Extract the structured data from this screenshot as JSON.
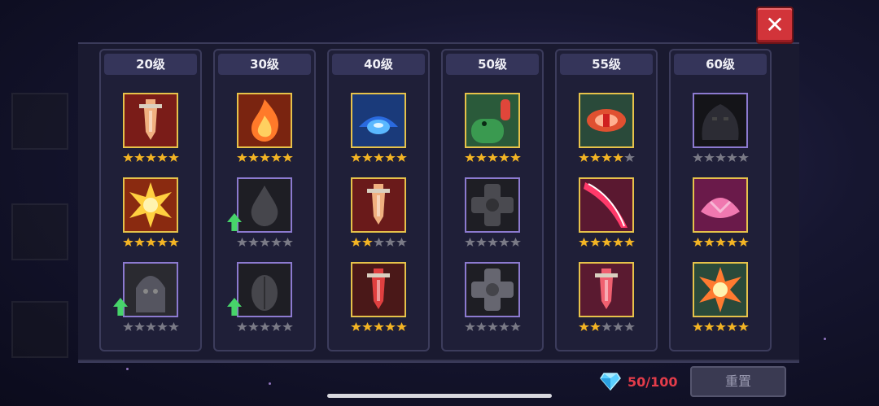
{
  "close_label": "✕",
  "columns": [
    {
      "level": "20级",
      "slots": [
        {
          "icon": "orange-sword-icon",
          "bg": "#7a1c18",
          "fg": "#f0b080",
          "stars_on": 5,
          "locked": false,
          "upgrade": false
        },
        {
          "icon": "explosion-burst-icon",
          "bg": "#8a2a10",
          "fg": "#ffd040",
          "stars_on": 5,
          "locked": false,
          "upgrade": false
        },
        {
          "icon": "hooded-reaper-icon",
          "bg": "#2a2a30",
          "fg": "#555560",
          "stars_on": 0,
          "locked": true,
          "upgrade": true
        }
      ]
    },
    {
      "level": "30级",
      "slots": [
        {
          "icon": "flame-icon",
          "bg": "#7a2410",
          "fg": "#ff7a2a",
          "stars_on": 5,
          "locked": false,
          "upgrade": false
        },
        {
          "icon": "droplet-icon",
          "bg": "#1e1e24",
          "fg": "#46464c",
          "stars_on": 0,
          "locked": true,
          "upgrade": true
        },
        {
          "icon": "seed-leaf-icon",
          "bg": "#1e1e24",
          "fg": "#46464c",
          "stars_on": 0,
          "locked": true,
          "upgrade": true
        }
      ]
    },
    {
      "level": "40级",
      "slots": [
        {
          "icon": "blue-gem-icon",
          "bg": "#1a3a7a",
          "fg": "#5ab8ff",
          "stars_on": 5,
          "locked": false,
          "upgrade": false
        },
        {
          "icon": "orange-sword-icon",
          "bg": "#6a1a1a",
          "fg": "#f0b080",
          "stars_on": 2,
          "locked": false,
          "upgrade": false
        },
        {
          "icon": "red-crystal-sword-icon",
          "bg": "#4a1818",
          "fg": "#e04040",
          "stars_on": 5,
          "locked": false,
          "upgrade": false
        }
      ]
    },
    {
      "level": "50级",
      "slots": [
        {
          "icon": "green-snake-icon",
          "bg": "#2a5a3a",
          "fg": "#3a9a50",
          "stars_on": 5,
          "locked": false,
          "upgrade": false
        },
        {
          "icon": "cross-shield-icon",
          "bg": "#1e1e24",
          "fg": "#4a4a50",
          "stars_on": 0,
          "locked": true,
          "upgrade": false
        },
        {
          "icon": "cross-shield-icon",
          "bg": "#1e1e24",
          "fg": "#666670",
          "stars_on": 0,
          "locked": true,
          "upgrade": false
        }
      ]
    },
    {
      "level": "55级",
      "slots": [
        {
          "icon": "red-eye-icon",
          "bg": "#2a4a3a",
          "fg": "#e05030",
          "stars_on": 4,
          "locked": false,
          "upgrade": false
        },
        {
          "icon": "red-slash-icon",
          "bg": "#5a1830",
          "fg": "#ff3a6a",
          "stars_on": 5,
          "locked": false,
          "upgrade": false
        },
        {
          "icon": "red-crystal-sword-icon",
          "bg": "#5a1a30",
          "fg": "#f06070",
          "stars_on": 2,
          "locked": false,
          "upgrade": false
        }
      ]
    },
    {
      "level": "60级",
      "slots": [
        {
          "icon": "shadow-beast-icon",
          "bg": "#141418",
          "fg": "#2c2c34",
          "stars_on": 0,
          "locked": true,
          "upgrade": false
        },
        {
          "icon": "pink-shell-icon",
          "bg": "#6a1a4a",
          "fg": "#f078b0",
          "stars_on": 5,
          "locked": false,
          "upgrade": false
        },
        {
          "icon": "sun-flower-icon",
          "bg": "#2a4a3a",
          "fg": "#ff7a30",
          "stars_on": 5,
          "locked": false,
          "upgrade": false
        }
      ]
    }
  ],
  "currency": {
    "value": "50/100",
    "icon": "diamond-icon",
    "color": "#e33c4a"
  },
  "reset_label": "重置"
}
